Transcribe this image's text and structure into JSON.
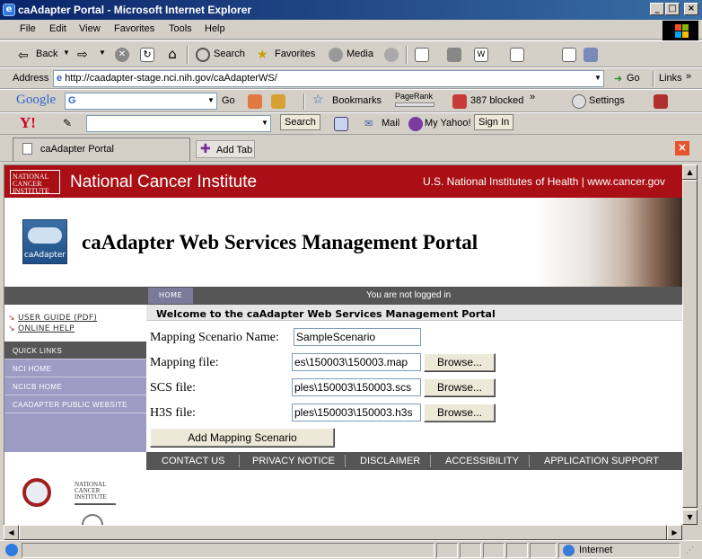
{
  "window": {
    "title": "caAdapter Portal - Microsoft Internet Explorer"
  },
  "menu": {
    "items": [
      "File",
      "Edit",
      "View",
      "Favorites",
      "Tools",
      "Help"
    ]
  },
  "toolbar": {
    "back": "Back",
    "search": "Search",
    "favorites": "Favorites",
    "media": "Media"
  },
  "address": {
    "label": "Address",
    "url": "http://caadapter-stage.nci.nih.gov/caAdapterWS/",
    "go": "Go",
    "links": "Links"
  },
  "google": {
    "logo": "Google",
    "search_prefix": "G",
    "go": "Go",
    "bookmarks": "Bookmarks",
    "pagerank": "PageRank",
    "blocked": "387 blocked",
    "settings": "Settings"
  },
  "yahoo": {
    "logo": "Y!",
    "search": "Search",
    "mail": "Mail",
    "my_yahoo": "My Yahoo!",
    "sign_in": "Sign In"
  },
  "tabs": {
    "active": "caAdapter Portal",
    "add": "Add Tab"
  },
  "nci": {
    "logo_text": "NATIONAL CANCER INSTITUTE",
    "name": "National Cancer Institute",
    "right": "U.S. National Institutes of Health | www.cancer.gov"
  },
  "header": {
    "logo_text": "caAdapter",
    "title": "caAdapter Web Services Management Portal"
  },
  "nav": {
    "home": "HOME",
    "login_status": "You are not logged in",
    "user_guide": "USER GUIDE (PDF)",
    "online_help": "ONLINE HELP",
    "quick_links": "QUICK LINKS",
    "links": [
      "NCI HOME",
      "NCICB HOME",
      "CAADAPTER PUBLIC WEBSITE"
    ]
  },
  "welcome": "Welcome to the caAdapter Web Services Management Portal",
  "form": {
    "scenario_label": "Mapping Scenario Name:",
    "scenario_value": "SampleScenario",
    "mapping_label": "Mapping file:",
    "mapping_value": "es\\150003\\150003.map",
    "scs_label": "SCS file:",
    "scs_value": "ples\\150003\\150003.scs",
    "h3s_label": "H3S file:",
    "h3s_value": "ples\\150003\\150003.h3s",
    "browse": "Browse...",
    "submit": "Add Mapping Scenario"
  },
  "footer": {
    "links": [
      "CONTACT US",
      "PRIVACY NOTICE",
      "DISCLAIMER",
      "ACCESSIBILITY",
      "APPLICATION SUPPORT"
    ],
    "nci_logo": "NATIONAL CANCER INSTITUTE"
  },
  "status": {
    "zone": "Internet"
  }
}
